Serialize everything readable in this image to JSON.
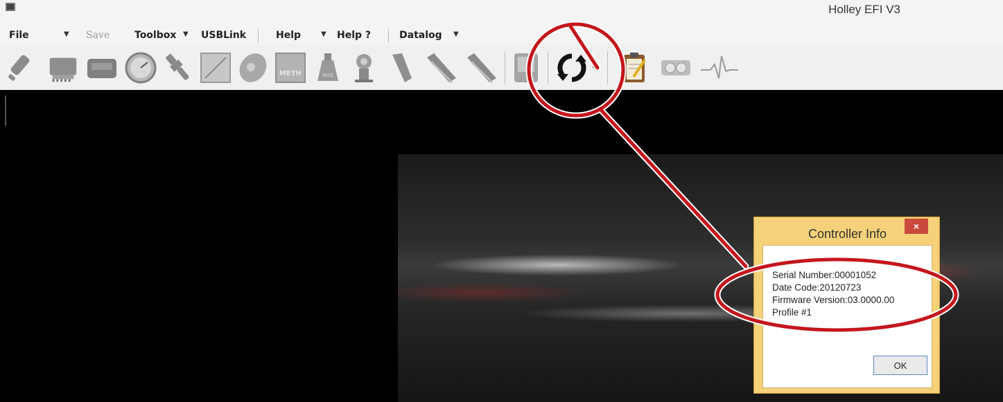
{
  "window": {
    "title": "Holley EFI V3"
  },
  "menu": {
    "file": "File",
    "save": "Save",
    "toolbox": "Toolbox",
    "usblink": "USBLink",
    "help": "Help",
    "help_q": "Help ?",
    "datalog": "Datalog"
  },
  "toolbar": {
    "icons": [
      "injector-icon",
      "ecu-icon",
      "module-icon",
      "gauge-icon",
      "sensor-icon",
      "curve-icon",
      "cam-icon",
      "methanol-icon",
      "nitrous-icon",
      "boost-icon",
      "pedal-icon",
      "harness-icon",
      "handheld-icon",
      "sync-icon",
      "clipboard-icon",
      "dashboard-icon",
      "pulse-icon"
    ],
    "methanol_text": "METH",
    "nitrous_text": "NOS"
  },
  "dialog": {
    "title": "Controller Info",
    "close": "×",
    "serial": "Serial Number:00001052",
    "date_code": "Date Code:20120723",
    "firmware": "Firmware Version:03.0000.00",
    "profile": "Profile #1",
    "ok": "OK"
  },
  "colors": {
    "annotation": "#c4161c",
    "dialog_frame": "#f5d27a",
    "close": "#c9493d"
  }
}
